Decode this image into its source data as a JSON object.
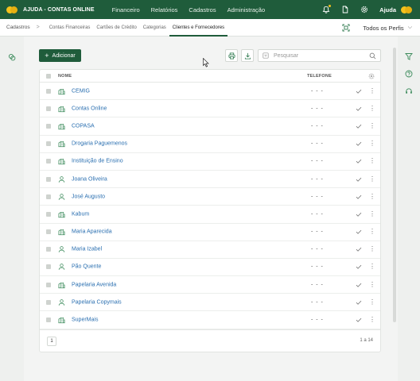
{
  "app": {
    "title": "AJUDA - CONTAS ONLINE"
  },
  "topnav": [
    "Financeiro",
    "Relatórios",
    "Cadastros",
    "Administração"
  ],
  "top_right": {
    "help_label": "Ajuda"
  },
  "breadcrumb": {
    "root": "Cadastros",
    "separator": ">"
  },
  "subtabs": [
    {
      "label": "Contas Financeiras",
      "active": false
    },
    {
      "label": "Cartões de Crédito",
      "active": false
    },
    {
      "label": "Categorias",
      "active": false
    },
    {
      "label": "Clientes e Fornecedores",
      "active": true
    }
  ],
  "profile": {
    "selected": "Todos os Perfis",
    "chevron": "⌵"
  },
  "toolbar": {
    "add_label": "Adicionar",
    "add_icon": "+",
    "search_placeholder": "Pesquisar"
  },
  "table": {
    "headers": {
      "name": "NOME",
      "phone": "TELEFONE"
    },
    "rows": [
      {
        "type": "company",
        "name": "CEMIG",
        "phone": "- - -"
      },
      {
        "type": "company",
        "name": "Contas Online",
        "phone": "- - -"
      },
      {
        "type": "company",
        "name": "COPASA",
        "phone": "- - -"
      },
      {
        "type": "company",
        "name": "Drogaria Paguemenos",
        "phone": "- - -"
      },
      {
        "type": "company",
        "name": "Instituição de Ensino",
        "phone": "- - -"
      },
      {
        "type": "person",
        "name": "Joana Oliveira",
        "phone": "- - -"
      },
      {
        "type": "person",
        "name": "José Augusto",
        "phone": "- - -"
      },
      {
        "type": "company",
        "name": "Kabum",
        "phone": "- - -"
      },
      {
        "type": "company",
        "name": "Maria Aparecida",
        "phone": "- - -"
      },
      {
        "type": "person",
        "name": "Maria Izabel",
        "phone": "- - -"
      },
      {
        "type": "person",
        "name": "Pão Quente",
        "phone": "- - -"
      },
      {
        "type": "company",
        "name": "Papelaria Avenida",
        "phone": "- - -"
      },
      {
        "type": "person",
        "name": "Papelaria Copymais",
        "phone": "- - -"
      },
      {
        "type": "company",
        "name": "SuperMais",
        "phone": "- - -"
      }
    ],
    "row_menu": "⋮"
  },
  "pager": {
    "page": "1",
    "range": "1 a 14"
  },
  "colors": {
    "brand": "#1f5c3b",
    "accent": "#f4c21d",
    "link": "#2a6fb0",
    "icon_green": "#3a8a5a"
  }
}
